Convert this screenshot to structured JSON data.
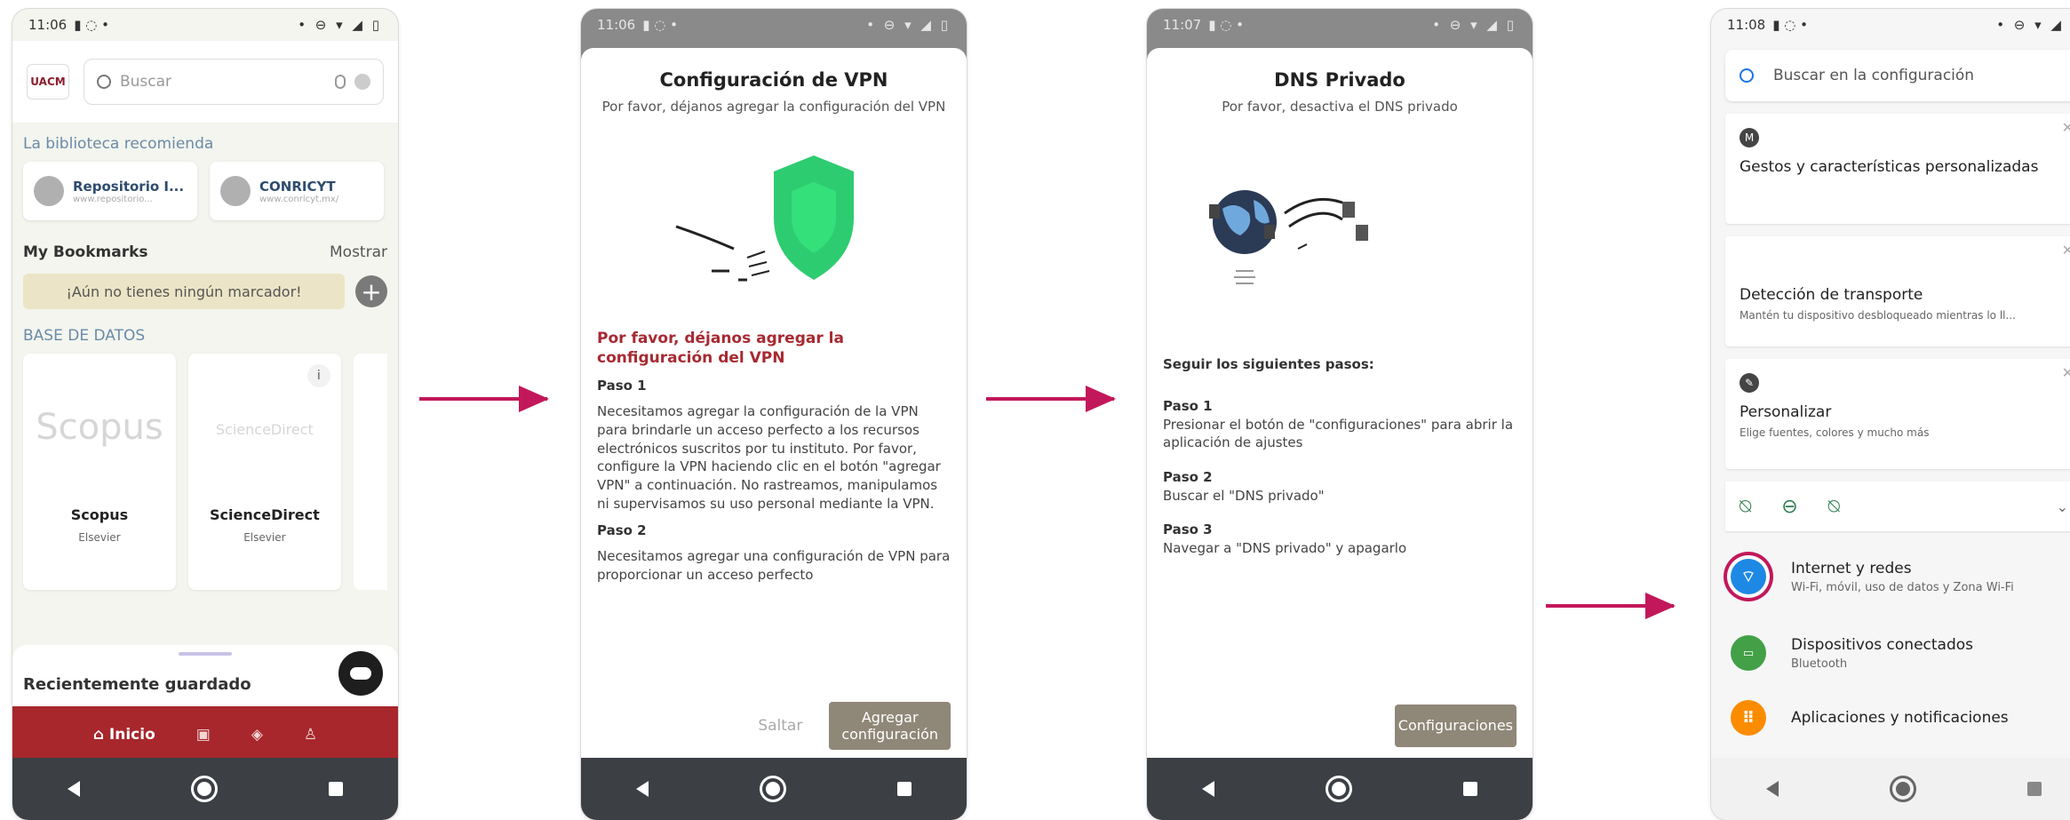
{
  "phone1": {
    "status_time": "11:06",
    "search_placeholder": "Buscar",
    "logo_text": "UACM",
    "recommend_title": "La biblioteca recomienda",
    "recommend": [
      {
        "name": "Repositorio I...",
        "url": "www.repositorio..."
      },
      {
        "name": "CONRICYT",
        "url": "www.conricyt.mx/"
      }
    ],
    "bookmarks_title": "My Bookmarks",
    "bookmarks_show": "Mostrar",
    "bookmarks_empty": "¡Aún no tienes ningún marcador!",
    "databases_title": "BASE DE DATOS",
    "databases": [
      {
        "logo": "Scopus",
        "name": "Scopus",
        "publisher": "Elsevier"
      },
      {
        "logo": "ScienceDirect",
        "name": "ScienceDirect",
        "publisher": "Elsevier"
      }
    ],
    "recent_title": "Recientemente guardado",
    "tab_home": "Inicio"
  },
  "phone2": {
    "status_time": "11:06",
    "title": "Configuración de VPN",
    "subtitle": "Por favor, déjanos agregar la configuración del VPN",
    "red_title": "Por favor, déjanos agregar la configuración del VPN",
    "step1_title": "Paso 1",
    "step1_text": "Necesitamos agregar la configuración de la VPN para brindarle un acceso perfecto a los recursos electrónicos suscritos por tu instituto. Por favor, configure la VPN haciendo clic en el botón \"agregar VPN\" a continuación. No rastreamos, manipulamos ni supervisamos su uso personal mediante la VPN.",
    "step2_title": "Paso 2",
    "step2_text": "Necesitamos agregar una configuración de VPN para proporcionar un acceso perfecto",
    "skip": "Saltar",
    "add_line1": "Agregar",
    "add_line2": "configuración"
  },
  "phone3": {
    "status_time": "11:07",
    "title": "DNS Privado",
    "subtitle": "Por favor, desactiva el DNS privado",
    "steps_title": "Seguir los siguientes pasos:",
    "steps": [
      {
        "title": "Paso 1",
        "text": "Presionar el botón de \"configuraciones\" para abrir la aplicación de ajustes"
      },
      {
        "title": "Paso 2",
        "text": "Buscar el \"DNS privado\""
      },
      {
        "title": "Paso 3",
        "text": "Navegar a \"DNS privado\" y apagarlo"
      }
    ],
    "button": "Configuraciones"
  },
  "phone4": {
    "status_time": "11:08",
    "search_placeholder": "Buscar en la configuración",
    "cards": [
      {
        "title": "Gestos y características personalizadas",
        "desc": ""
      },
      {
        "title": "Detección de transporte",
        "desc": "Mantén tu dispositivo desbloqueado mientras lo ll..."
      },
      {
        "title": "Personalizar",
        "desc": "Elige fuentes, colores y mucho más"
      }
    ],
    "items": [
      {
        "title": "Internet y redes",
        "desc": "Wi-Fi, móvil, uso de datos y Zona Wi-Fi",
        "color": "#1e88e5"
      },
      {
        "title": "Dispositivos conectados",
        "desc": "Bluetooth",
        "color": "#43a047"
      },
      {
        "title": "Aplicaciones y notificaciones",
        "desc": "",
        "color": "#fb8c00"
      }
    ]
  },
  "colors": {
    "accent": "#c2185b",
    "brand_red": "#a7272c"
  }
}
